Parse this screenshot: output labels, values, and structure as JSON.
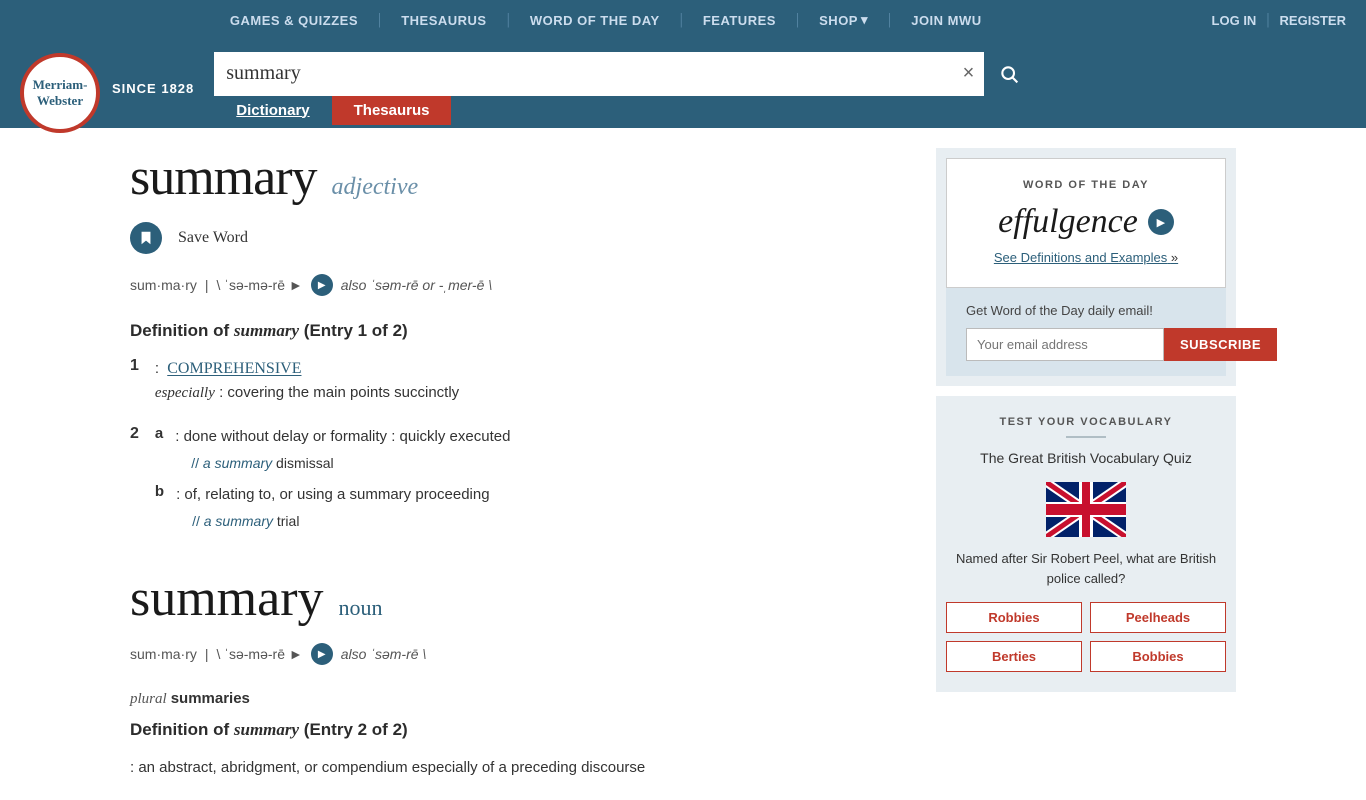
{
  "header": {
    "nav": {
      "games": "GAMES & QUIZZES",
      "thesaurus": "THESAURUS",
      "wotd": "WORD OF THE DAY",
      "features": "FEATURES",
      "shop": "SHOP",
      "join": "JOIN MWU",
      "login": "LOG IN",
      "register": "REGISTER"
    },
    "logo": {
      "line1": "Merriam-",
      "line2": "Webster",
      "since": "SINCE 1828"
    },
    "search": {
      "value": "summary",
      "placeholder": "search"
    },
    "tabs": {
      "dictionary": "Dictionary",
      "thesaurus": "Thesaurus"
    }
  },
  "entry1": {
    "word": "summary",
    "pos": "adjective",
    "syllables": "sum·ma·ry",
    "pronunciation": "\\ ˈsə-mə-rē ►",
    "pron_alt": "also ˈsəm-rē or -ˌmer-ē \\",
    "definition_header": "Definition of summary (Entry 1 of 2)",
    "def1": {
      "num": "1",
      "link_text": "COMPREHENSIVE",
      "especially": "especially",
      "rest": ": covering the main points succinctly"
    },
    "def2a": {
      "letter": "a",
      "text": ": done without delay or formality : quickly executed",
      "example_marker": "//",
      "example_word": "a summary",
      "example_rest": "dismissal"
    },
    "def2b": {
      "letter": "b",
      "text": ": of, relating to, or using a summary proceeding",
      "example_marker": "//",
      "example_word": "a summary",
      "example_rest": "trial"
    }
  },
  "entry2": {
    "word": "summary",
    "pos": "noun",
    "syllables": "sum·ma·ry",
    "pronunciation": "\\ ˈsə-mə-rē ►",
    "pron_alt": "also ˈsəm-rē \\",
    "plural_label": "plural",
    "plural_word": "summaries",
    "definition_header": "Definition of summary (Entry 2 of 2)",
    "def_text": ": an abstract, abridgment, or compendium especially of a preceding discourse"
  },
  "sidebar": {
    "wotd": {
      "label": "WORD OF THE DAY",
      "word": "effulgence",
      "see_link": "See Definitions and Examples",
      "arrow": "»",
      "email_label": "Get Word of the Day daily email!",
      "email_placeholder": "Your email address",
      "subscribe_btn": "SUBSCRIBE"
    },
    "vocab": {
      "label": "TEST YOUR VOCABULARY",
      "quiz_title": "The Great British Vocabulary Quiz",
      "question": "Named after Sir Robert Peel, what are British police called?",
      "btn1": "Robbies",
      "btn2": "Peelheads",
      "btn3": "Berties",
      "btn4": "Bobbies"
    }
  },
  "icons": {
    "search": "🔍",
    "clear": "×",
    "speaker": "►",
    "bookmark": "🔖",
    "chevron_down": "▾"
  }
}
